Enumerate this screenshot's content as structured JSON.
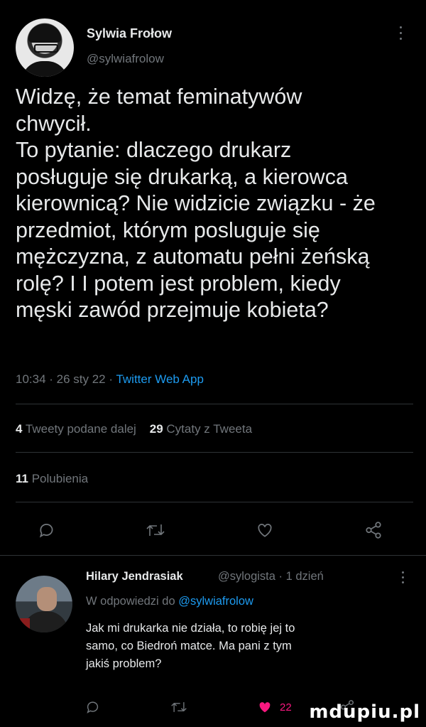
{
  "tweet": {
    "author_name": "Sylwia Frołow",
    "author_handle": "@sylwiafrolow",
    "text": "Widzę, że temat feminatywów\nchwycił.\nTo pytanie: dlaczego drukarz\nposługuje się drukarką, a kierowca\nkierownicą? Nie widzicie związku - że\nprzedmiot, którym posluguje się\nmężczyzna, z automatu pełni żeńską\nrolę? I I potem jest problem, kiedy\nmęski zawód przejmuje kobieta?",
    "time": "10:34 · 26 sty 22 · ",
    "source": "Twitter Web App",
    "retweets_count": "4",
    "retweets_label": "Tweety podane dalej",
    "quotes_count": "29",
    "quotes_label": "Cytaty z Tweeta",
    "likes_count": "11",
    "likes_label": "Polubienia",
    "icons": [
      "reply-icon",
      "retweet-icon",
      "like-icon",
      "share-icon"
    ]
  },
  "reply": {
    "author_name": "Hilary Jendrasiak",
    "author_handle": "@sylogista · 1 dzień",
    "replying_prefix": "W odpowiedzi do ",
    "replying_to": "@sylwiafrolow",
    "text": "Jak mi drukarka nie działa, to robię jej to\nsamo, co Biedroń matce. Ma pani z tym\njakiś problem?",
    "like_count": "22",
    "like_color": "#f91880"
  },
  "watermark": "mdupiu.pl"
}
